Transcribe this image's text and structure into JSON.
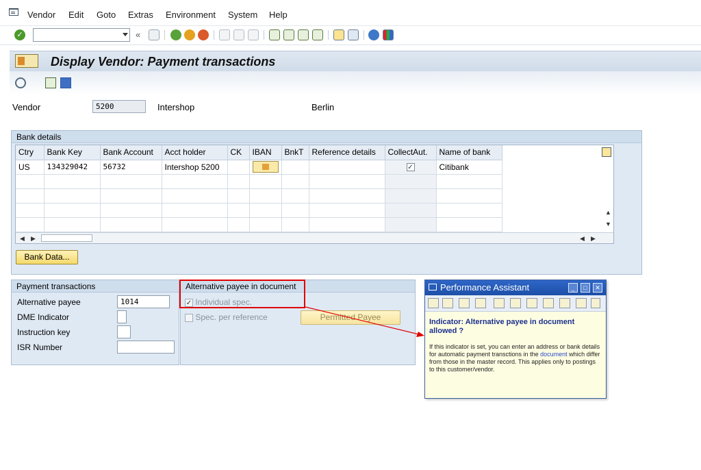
{
  "menu": {
    "items": [
      "Vendor",
      "Edit",
      "Goto",
      "Extras",
      "Environment",
      "System",
      "Help"
    ]
  },
  "toolbar": {
    "command_value": "",
    "back_symbol": "«"
  },
  "header": {
    "title": "Display Vendor: Payment transactions"
  },
  "vendor": {
    "label": "Vendor",
    "number": "5200",
    "name": "Intershop",
    "city": "Berlin"
  },
  "bank_details": {
    "title": "Bank details",
    "columns": [
      "Ctry",
      "Bank Key",
      "Bank Account",
      "Acct holder",
      "CK",
      "IBAN",
      "BnkT",
      "Reference details",
      "CollectAut.",
      "Name of bank"
    ],
    "rows": [
      {
        "ctry": "US",
        "bank_key": "134329042",
        "bank_account": "56732",
        "acct_holder": "Intershop 5200",
        "ck": "",
        "bnkt": "",
        "reference": "",
        "collect": "✓",
        "bank_name": "Citibank"
      }
    ],
    "bank_data_button": "Bank Data..."
  },
  "payment_transactions": {
    "title": "Payment transactions",
    "alternative_payee_label": "Alternative payee",
    "alternative_payee_value": "1014",
    "dme_indicator_label": "DME Indicator",
    "instruction_key_label": "Instruction key",
    "isr_number_label": "ISR Number"
  },
  "alt_payee_doc": {
    "title": "Alternative payee in document",
    "individual_spec_label": "Individual spec.",
    "individual_spec_checked": "✓",
    "spec_per_reference_label": "Spec. per reference",
    "permitted_payee_button": "Permitted Payee"
  },
  "performance_assistant": {
    "title": "Performance Assistant",
    "heading": "Indicator: Alternative payee in document allowed ?",
    "text_before_link": "If this indicator is set, you can enter an address or bank details for automatic payment transctions in the ",
    "link": "document",
    "text_after_link": " which differ from those in the master record. This applies only to postings to this customer/vendor."
  },
  "colors": {
    "accent_red": "#e00000",
    "title_bar_blue": "#1c4fa8",
    "group_bg": "#dfe9f4",
    "button_yellow": "#f4d96c"
  }
}
